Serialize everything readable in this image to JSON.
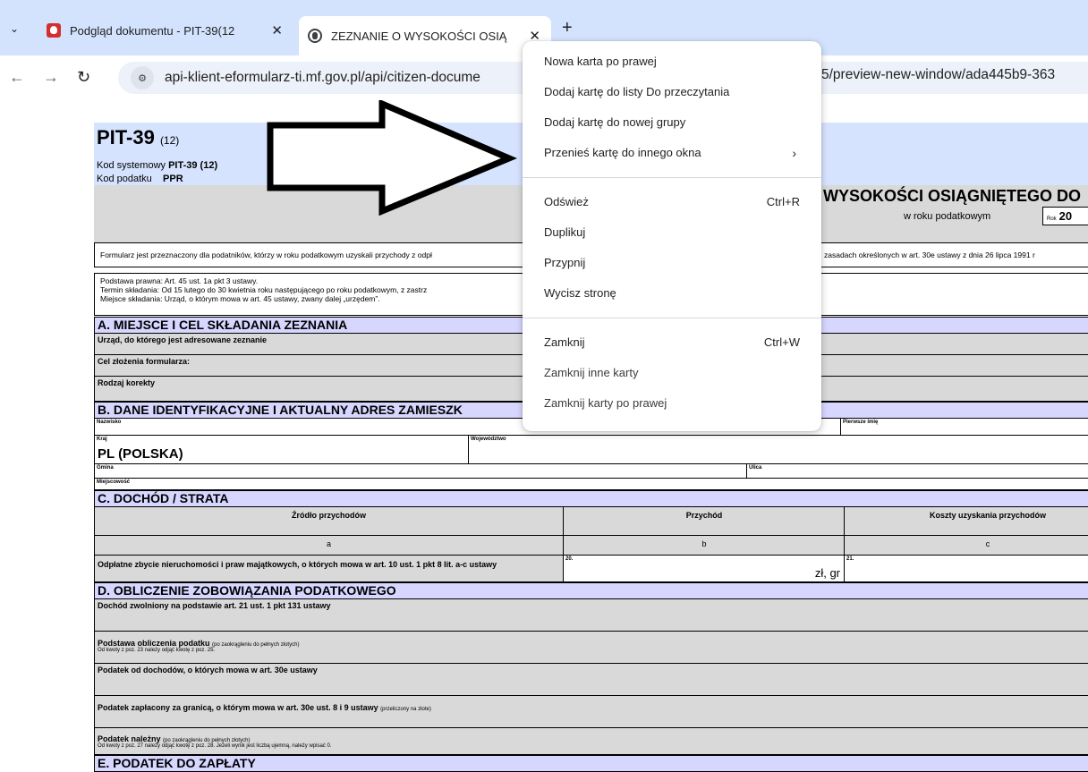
{
  "browser": {
    "tabs": [
      {
        "title": "Podgląd dokumentu - PIT-39(12",
        "active": false
      },
      {
        "title": "ZEZNANIE O WYSOKOŚCI OSIĄ",
        "active": true
      }
    ],
    "close_glyph": "✕",
    "new_tab_glyph": "+",
    "tab_list_glyph": "⌄",
    "address": "api-klient-eformularz-ti.mf.gov.pl/api/citizen-docume",
    "address_tail": "5/preview-new-window/ada445b9-363",
    "icons": [
      "chevron-down-icon",
      "pl-emblem-icon",
      "globe-icon",
      "back-icon",
      "forward-icon",
      "reload-icon",
      "site-info-icon"
    ]
  },
  "context_menu": {
    "items": [
      {
        "label": "Nowa karta po prawej"
      },
      {
        "label": "Dodaj kartę do listy Do przeczytania"
      },
      {
        "label": "Dodaj kartę do nowej grupy"
      },
      {
        "label": "Przenieś kartę do innego okna",
        "submenu": "›"
      },
      {
        "label": "Odśwież",
        "shortcut": "Ctrl+R"
      },
      {
        "label": "Duplikuj"
      },
      {
        "label": "Przypnij"
      },
      {
        "label": "Wycisz stronę"
      },
      {
        "label": "Zamknij",
        "shortcut": "Ctrl+W"
      },
      {
        "label": "Zamknij inne karty"
      },
      {
        "label": "Zamknij karty po prawej"
      }
    ]
  },
  "document": {
    "form_code": "PIT-39",
    "form_version": "(12)",
    "kod_systemowy_label": "Kod systemowy",
    "kod_systemowy_value": "PIT-39 (12)",
    "kod_podatku_label": "Kod podatku",
    "kod_podatku_value": "PPR",
    "title": "WYSOKOŚCI OSIĄGNIĘTEGO DO",
    "w_roku": "w roku podatkowym",
    "rok_label": "Rok",
    "rok_value": "20",
    "intro_left": "Formularz jest przeznaczony dla podatników, którzy w roku podatkowym uzyskali przychody z odpł",
    "intro_right": "zasadach określonych w art. 30e ustawy z dnia 26 lipca 1991 r",
    "podstawa": [
      "Podstawa prawna:   Art. 45 ust. 1a pkt 3 ustawy.",
      "Termin składania:    Od 15 lutego do 30 kwietnia roku następującego po roku podatkowym, z zastrz",
      "Miejsce składania:   Urząd, o którym mowa w art. 45 ustawy, zwany dalej „urzędem”."
    ],
    "section_a": "A. MIEJSCE I CEL SKŁADANIA ZEZNANIA",
    "a_rows": [
      "Urząd, do którego jest adresowane zeznanie",
      "Cel złożenia formularza:",
      "Rodzaj korekty"
    ],
    "section_b": "B.  DANE IDENTYFIKACYJNE I AKTUALNY ADRES ZAMIESZK",
    "b_nazwisko": "Nazwisko",
    "b_pierwsze_imie": "Pierwsze imię",
    "b_kraj": "Kraj",
    "b_kraj_value": "PL  (POLSKA)",
    "b_wojewodztwo": "Województwo",
    "b_gmina": "Gmina",
    "b_ulica": "Ulica",
    "b_miejscowosc": "Miejscowość",
    "section_c": "C. DOCHÓD / STRATA",
    "c_headers": [
      "Źródło przychodów",
      "Przychód",
      "Koszty uzyskania przychodów"
    ],
    "c_letters": [
      "a",
      "b",
      "c"
    ],
    "c_row_label": "Odpłatne zbycie nieruchomości i praw majątkowych, o których mowa w art. 10 ust. 1 pkt 8 lit. a-c ustawy",
    "c_pos20": "20.",
    "c_pos21": "21.",
    "c_currency": "zł, gr",
    "section_d": "D. OBLICZENIE ZOBOWIĄZANIA PODATKOWEGO",
    "d_rows": [
      {
        "label": "Dochód zwolniony na podstawie art. 21 ust. 1 pkt 131 ustawy",
        "note": "",
        "sub": ""
      },
      {
        "label": "Podstawa obliczenia podatku",
        "note": "(po zaokrągleniu do pełnych złotych)",
        "sub": "Od kwoty z poz. 23 należy odjąć kwotę z poz. 25."
      },
      {
        "label": "Podatek od dochodów, o których mowa w art. 30e ustawy",
        "note": "",
        "sub": ""
      },
      {
        "label": "Podatek zapłacony za granicą, o którym mowa w art. 30e ust. 8 i 9 ustawy",
        "note": "(przeliczony na złote)",
        "sub": ""
      },
      {
        "label": "Podatek należny",
        "note": "(po zaokrągleniu do pełnych złotych)",
        "sub": "Od kwoty z poz. 27 należy odjąć kwotę z poz. 28. Jeżeli wynik jest liczbą ujemną, należy wpisać 0."
      }
    ],
    "section_e": "E. PODATEK DO ZAPŁATY"
  },
  "colors": {
    "tabbar": "#d3e3fd",
    "header_blue": "#d6e3ff",
    "section_lilac": "#d6d6ff",
    "field_grey": "#d9d9d9"
  }
}
